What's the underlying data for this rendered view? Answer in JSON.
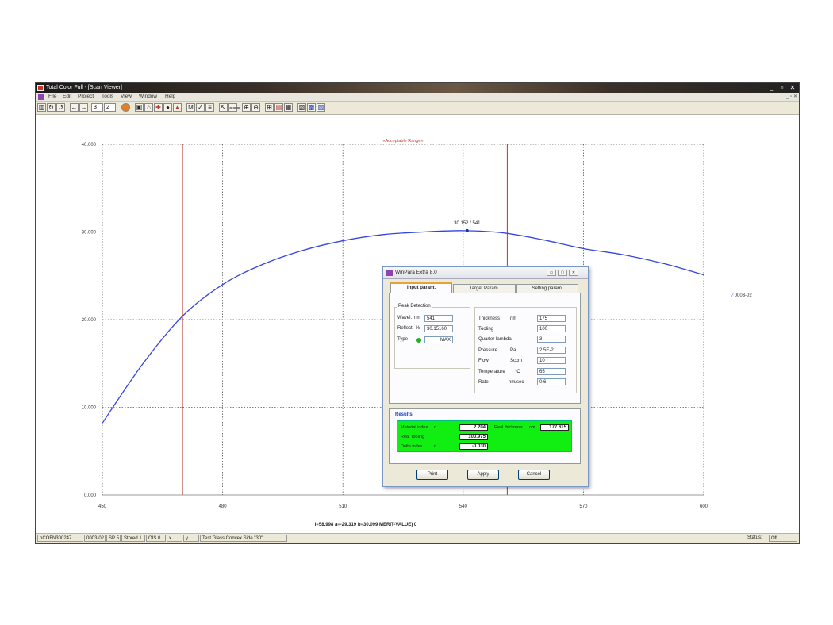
{
  "window": {
    "title": "Total Color Full - [Scan Viewer]",
    "controls": [
      "_",
      "▫",
      "✕"
    ],
    "mdi_controls": "_ ▫ ✕"
  },
  "menu": [
    "File",
    "Edit",
    "Project",
    "Tools",
    "View",
    "Window",
    "Help"
  ],
  "toolbar": {
    "spin_value": "3",
    "spin_value2": "2"
  },
  "chart_data": {
    "type": "line",
    "title": "«Acceptable Range»",
    "x_ticks": [
      "450",
      "480",
      "510",
      "540",
      "570",
      "600"
    ],
    "y_ticks": [
      "0.000",
      "10.000",
      "20.000",
      "30.000",
      "40.000"
    ],
    "xlim": [
      450,
      600
    ],
    "ylim": [
      0,
      40
    ],
    "grid": true,
    "range_lines_x": [
      470,
      551
    ],
    "series": [
      {
        "name": "0003-02",
        "color": "#3344dd",
        "x": [
          450,
          460,
          470,
          480,
          490,
          500,
          510,
          520,
          530,
          540,
          550,
          560,
          570,
          580,
          590,
          600
        ],
        "y": [
          8.2,
          14.9,
          20.4,
          24.0,
          26.3,
          27.9,
          29.0,
          29.7,
          30.0,
          30.15,
          29.9,
          29.1,
          28.1,
          27.4,
          26.4,
          25.1
        ]
      }
    ],
    "peak_label": "30.152 / 541",
    "peak_point": {
      "x": 541,
      "y": 30.152
    },
    "footer_text": "l=58.998 a=-29.319 b=30.099 MERIT-VALUE) 0"
  },
  "status_bar": {
    "items": [
      "nCOFN300247",
      "0003-02",
      "SP 5",
      "Stored 1",
      "OIS 0",
      "x",
      "y",
      "Test Glass Convex Side \"30\""
    ],
    "status_label": "Status:",
    "status_value": "Off"
  },
  "dialog": {
    "title": "WinPara Extra 8.0",
    "controls": [
      "▭",
      "▢",
      "✕"
    ],
    "tabs": [
      "Input param.",
      "Target Param.",
      "Setting param."
    ],
    "peak_detection": {
      "label": "Peak Detection",
      "wavel_label": "Wavel.",
      "wavel_unit": "nm",
      "wavel_value": "541",
      "reflect_label": "Reflect.",
      "reflect_unit": "%",
      "reflect_value": "30.15160",
      "type_label": "Type",
      "type_value": "MAX"
    },
    "params": [
      {
        "label": "Thickness",
        "unit": "nm",
        "value": "175"
      },
      {
        "label": "Tooling",
        "unit": "",
        "value": "100"
      },
      {
        "label": "Quarter lambda",
        "unit": "",
        "value": "3"
      },
      {
        "label": "Pressure",
        "unit": "Pa",
        "value": "2.5E-2"
      },
      {
        "label": "Flow",
        "unit": "Sccm",
        "value": "10"
      },
      {
        "label": "Temperature",
        "unit": "°C",
        "value": "65"
      },
      {
        "label": "Rate",
        "unit": "nm/sec",
        "value": "0.6"
      }
    ],
    "results": {
      "label": "Results",
      "material_index_label": "Material index",
      "material_index_unit": "n",
      "material_index_value": "2.204",
      "real_thickness_label": "Real thickness",
      "real_thickness_unit": "nm",
      "real_thickness_value": "177.615",
      "real_tooling_label": "Real Tooling",
      "real_tooling_value": "100.975",
      "delta_index_label": "Delta index",
      "delta_index_unit": "n",
      "delta_index_value": "-0.030"
    },
    "buttons": {
      "print": "Print",
      "apply": "Apply",
      "cancel": "Cancel"
    }
  }
}
